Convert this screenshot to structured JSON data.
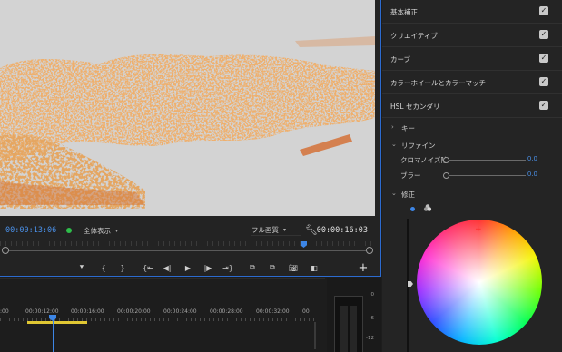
{
  "monitor": {
    "timecode_current": "00:00:13:06",
    "zoom": "全体表示",
    "quality": "フル画質",
    "timecode_duration": "00:00:16:03"
  },
  "timeline": {
    "ruler_labels": [
      ":00",
      "00:00:12:00",
      "00:00:16:00",
      "00:00:20:00",
      "00:00:24:00",
      "00:00:28:00",
      "00:00:32:00",
      "00"
    ]
  },
  "meter": {
    "labels": [
      "0",
      "-6",
      "-12"
    ]
  },
  "lumetri": {
    "sections": [
      {
        "label": "基本補正",
        "checked": true
      },
      {
        "label": "クリエイティブ",
        "checked": true
      },
      {
        "label": "カーブ",
        "checked": true
      },
      {
        "label": "カラーホイールとカラーマッチ",
        "checked": true
      },
      {
        "label": "HSL セカンダリ",
        "checked": true
      }
    ],
    "key_label": "キー",
    "refine_label": "リファイン",
    "sliders": [
      {
        "label": "クロマノイズ除",
        "value": "0.0"
      },
      {
        "label": "ブラー",
        "value": "0.0"
      }
    ],
    "correction_label": "修正"
  },
  "icons": {
    "wrench": "wrench-icon",
    "add": "add-icon",
    "colors": {
      "accent": "#3d86e6",
      "workarea": "#e0c733",
      "status": "#2ebd4a"
    }
  }
}
